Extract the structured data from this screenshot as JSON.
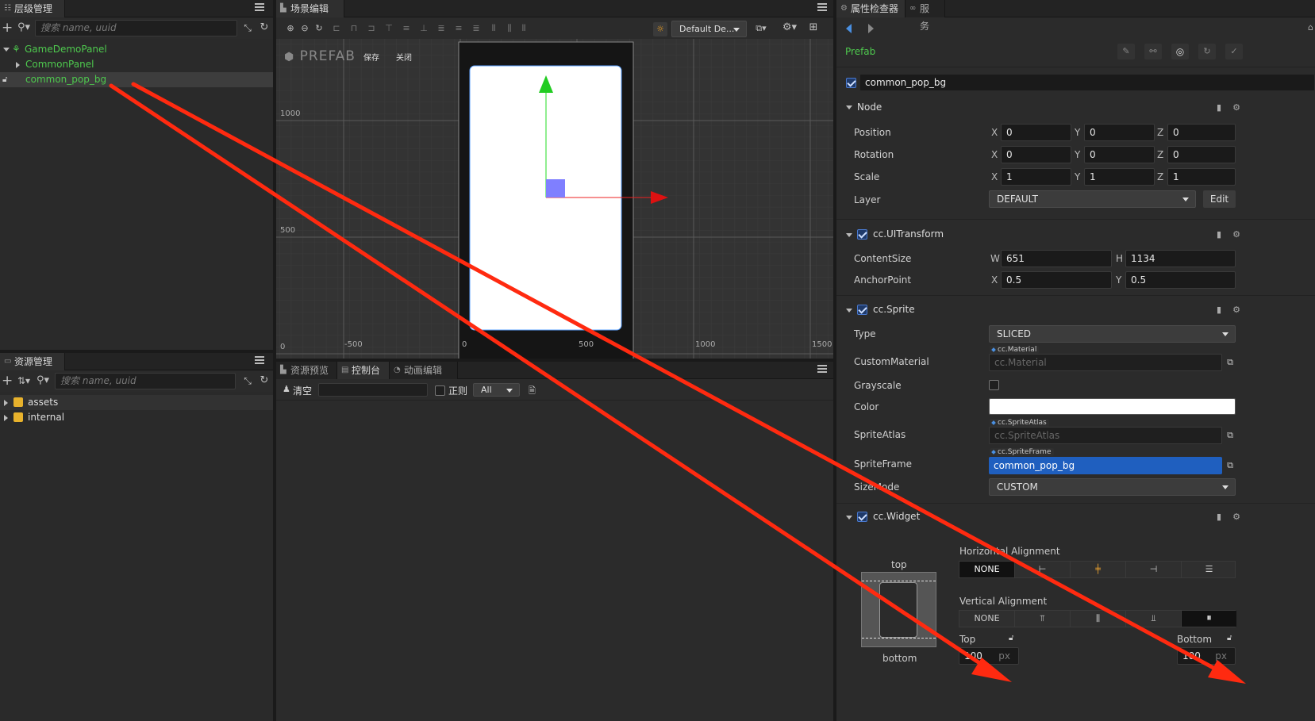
{
  "hierarchy": {
    "tab_label": "层级管理器",
    "search_placeholder": "搜索 name, uuid",
    "items": [
      {
        "label": "GameDemoPanel"
      },
      {
        "label": "CommonPanel"
      },
      {
        "label": "common_pop_bg"
      }
    ]
  },
  "assets": {
    "tab_label": "资源管理器",
    "search_placeholder": "搜索 name, uuid",
    "items": [
      {
        "label": "assets"
      },
      {
        "label": "internal"
      }
    ]
  },
  "scene": {
    "tab_label": "场景编辑器",
    "prefab_label": "PREFAB",
    "save_label": "保存",
    "close_label": "关闭",
    "camera_select": "Default De...",
    "y_ticks": [
      "1000",
      "500",
      "0"
    ],
    "x_ticks": [
      "-500",
      "0",
      "500",
      "1000",
      "1500"
    ]
  },
  "console": {
    "tabs": [
      "资源预览",
      "控制台",
      "动画编辑器"
    ],
    "clear_label": "清空",
    "regex_label": "正则",
    "filter_value": "All"
  },
  "inspector": {
    "tabs": [
      "属性检查器",
      "服务"
    ],
    "prefab_label": "Prefab",
    "node_name": "common_pop_bg",
    "node": {
      "title": "Node",
      "position_label": "Position",
      "rotation_label": "Rotation",
      "scale_label": "Scale",
      "layer_label": "Layer",
      "axis_x": "X",
      "axis_y": "Y",
      "axis_z": "Z",
      "position": [
        "0",
        "0",
        "0"
      ],
      "rotation": [
        "0",
        "0",
        "0"
      ],
      "scale": [
        "1",
        "1",
        "1"
      ],
      "layer_value": "DEFAULT",
      "edit_label": "Edit"
    },
    "uitransform": {
      "title": "cc.UITransform",
      "content_size_label": "ContentSize",
      "anchor_label": "AnchorPoint",
      "w_label": "W",
      "h_label": "H",
      "w": "651",
      "h": "1134",
      "ax": "0.5",
      "ay": "0.5"
    },
    "sprite": {
      "title": "cc.Sprite",
      "type_label": "Type",
      "type_value": "SLICED",
      "custom_material_label": "CustomMaterial",
      "material_tag": "cc.Material",
      "material_placeholder": "cc.Material",
      "grayscale_label": "Grayscale",
      "color_label": "Color",
      "color_value": "#ffffff",
      "atlas_label": "SpriteAtlas",
      "atlas_tag": "cc.SpriteAtlas",
      "atlas_placeholder": "cc.SpriteAtlas",
      "frame_label": "SpriteFrame",
      "frame_tag": "cc.SpriteFrame",
      "frame_value": "common_pop_bg",
      "sizemode_label": "SizeMode",
      "sizemode_value": "CUSTOM"
    },
    "widget": {
      "title": "cc.Widget",
      "top_label": "top",
      "bottom_label": "bottom",
      "horizontal_label": "Horizontal Alignment",
      "vertical_label": "Vertical Alignment",
      "none_label": "NONE",
      "top_field_label": "Top",
      "bottom_field_label": "Bottom",
      "top_value": "100",
      "bottom_value": "100",
      "unit": "px"
    }
  },
  "colors": {
    "accent_green": "#4ec94e",
    "annotation_red": "#ff2a10",
    "selection_blue": "#1f5fbf"
  }
}
